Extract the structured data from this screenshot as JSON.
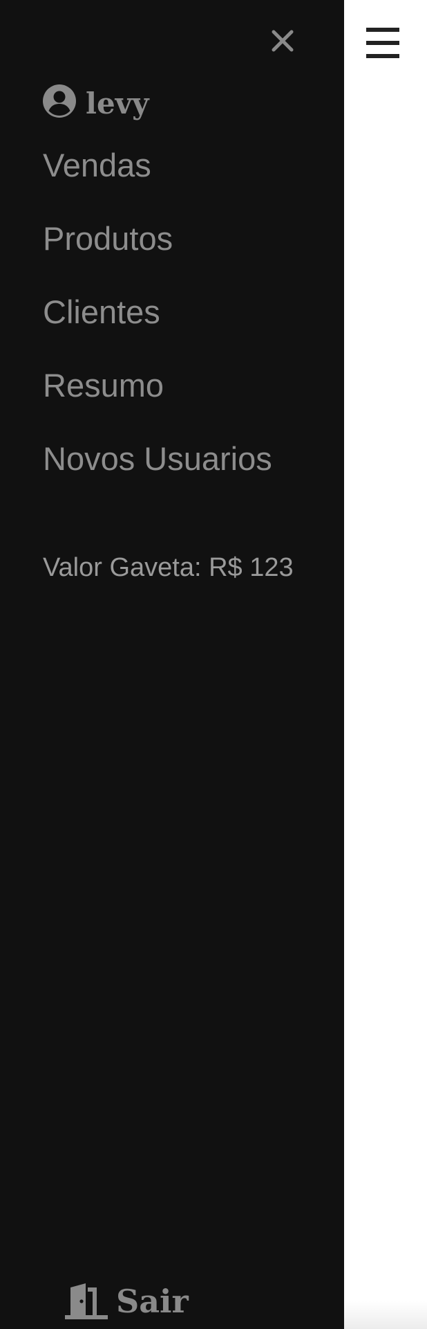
{
  "drawer": {
    "user": {
      "name": "levy",
      "icon": "user-circle-icon"
    },
    "close_icon": "close-icon",
    "nav_items": [
      {
        "label": "Vendas"
      },
      {
        "label": "Produtos"
      },
      {
        "label": "Clientes"
      },
      {
        "label": "Resumo"
      },
      {
        "label": "Novos Usuarios"
      }
    ],
    "drawer_value_text": "Valor Gaveta: R$ 123",
    "logout": {
      "label": "Sair",
      "icon": "door-exit-icon"
    }
  },
  "header": {
    "menu_icon": "hamburger-menu-icon"
  },
  "colors": {
    "drawer_background": "#111111",
    "drawer_text": "#8d8d8d",
    "page_background": "#ffffff",
    "menu_icon": "#222222"
  }
}
